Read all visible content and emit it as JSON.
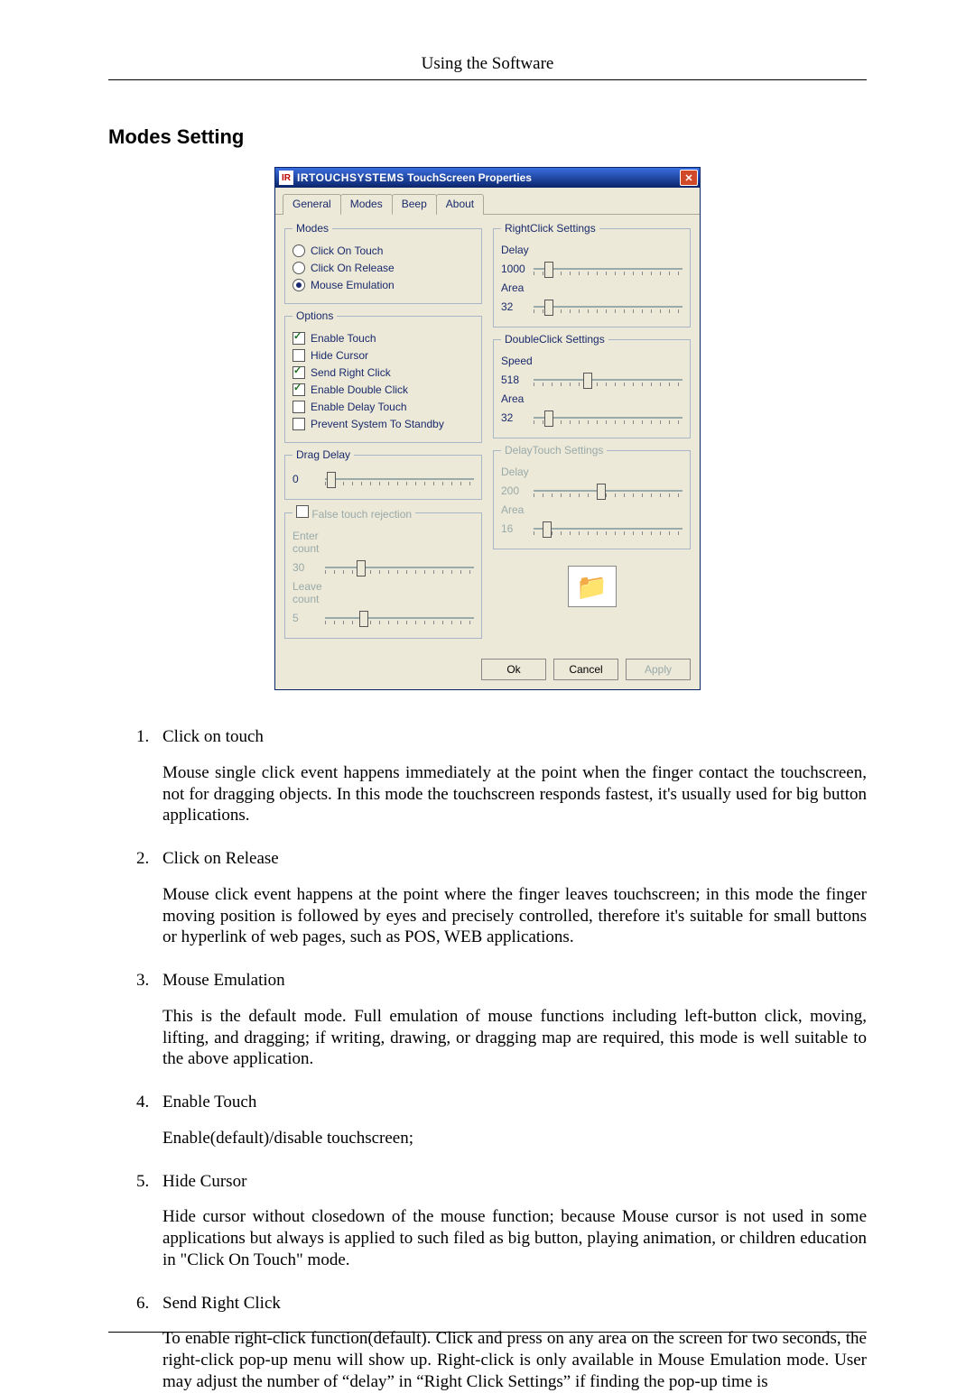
{
  "header": {
    "running": "Using the Software"
  },
  "section": {
    "title": "Modes Setting"
  },
  "dialog": {
    "logo": "IR",
    "title_brand": "IRTOUCHSYSTEMS",
    "title_rest": "TouchScreen Properties",
    "tabs": {
      "general": "General",
      "modes": "Modes",
      "beep": "Beep",
      "about": "About"
    },
    "modes_group": {
      "legend": "Modes",
      "click_touch": "Click On Touch",
      "click_release": "Click On Release",
      "mouse_emu": "Mouse Emulation"
    },
    "options_group": {
      "legend": "Options",
      "enable_touch": "Enable Touch",
      "hide_cursor": "Hide Cursor",
      "send_right": "Send Right Click",
      "enable_double": "Enable Double Click",
      "enable_delay": "Enable Delay Touch",
      "prevent_standby": "Prevent System To Standby"
    },
    "drag_delay": {
      "legend": "Drag Delay",
      "value": "0"
    },
    "false_touch": {
      "legend": "False touch rejection",
      "enter_label": "Enter count",
      "enter_value": "30",
      "leave_label": "Leave count",
      "leave_value": "5"
    },
    "right_click": {
      "legend": "RightClick Settings",
      "delay_label": "Delay",
      "delay_value": "1000",
      "area_label": "Area",
      "area_value": "32"
    },
    "double_click": {
      "legend": "DoubleClick Settings",
      "speed_label": "Speed",
      "speed_value": "518",
      "area_label": "Area",
      "area_value": "32"
    },
    "delay_touch": {
      "legend": "DelayTouch Settings",
      "delay_label": "Delay",
      "delay_value": "200",
      "area_label": "Area",
      "area_value": "16"
    },
    "buttons": {
      "ok": "Ok",
      "cancel": "Cancel",
      "apply": "Apply"
    }
  },
  "list": {
    "i1": {
      "t": "Click on touch",
      "p": "Mouse single click event happens immediately at the point when the finger contact the touchscreen, not for dragging objects. In this mode the touchscreen responds fastest, it's usually used for big button applications."
    },
    "i2": {
      "t": "Click on Release",
      "p": "Mouse click event happens at the point where the finger leaves touchscreen; in this mode the finger moving position is followed by eyes and precisely controlled, therefore it's suitable for small buttons or hyperlink of web pages, such as POS, WEB applications."
    },
    "i3": {
      "t": "Mouse Emulation",
      "p": "This is the default mode. Full emulation of mouse functions including left-button click, moving, lifting, and dragging; if writing, drawing, or dragging map are required, this mode is well suitable to the above application."
    },
    "i4": {
      "t": "Enable Touch",
      "p": "Enable(default)/disable touchscreen;"
    },
    "i5": {
      "t": "Hide Cursor",
      "p": "Hide cursor without closedown of the mouse function; because Mouse cursor is not used in some applications but always is applied to such filed as big button, playing animation, or children education in \"Click On Touch\" mode."
    },
    "i6": {
      "t": "Send Right Click",
      "p": "To enable right-click function(default). Click and press on any area on the screen for two seconds, the right-click pop-up menu will show up. Right-click is only available in Mouse Emulation mode. User may adjust the number of “delay” in “Right Click Settings” if finding the pop-up time is"
    }
  }
}
